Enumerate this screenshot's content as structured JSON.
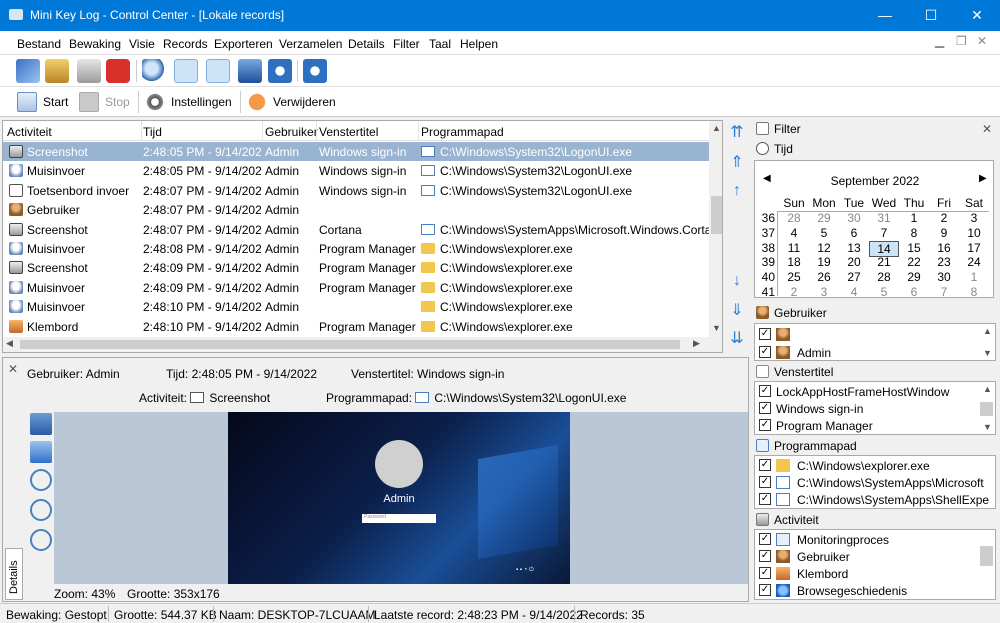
{
  "window": {
    "title": "Mini Key Log - Control Center - [Lokale records]",
    "minimize": "—",
    "maximize": "☐",
    "close": "✕"
  },
  "menu": [
    "Bestand",
    "Bewaking",
    "Visie",
    "Records",
    "Exporteren",
    "Verzamelen",
    "Details",
    "Filter",
    "Taal",
    "Helpen"
  ],
  "toolbar1_icons": [
    "edit-icon",
    "lock-icon",
    "calendar-icon",
    "power-icon",
    "search-icon",
    "filter-icon",
    "pencil-icon",
    "export-icon",
    "info-icon",
    "help-icon"
  ],
  "toolbar2": {
    "start": "Start",
    "stop": "Stop",
    "settings": "Instellingen",
    "delete": "Verwijderen"
  },
  "grid": {
    "columns": [
      "Activiteit",
      "Tijd",
      "Gebruiker",
      "Venstertitel",
      "Programmapad"
    ],
    "rows": [
      {
        "activity": "Screenshot",
        "icon": "camera",
        "time": "2:48:05 PM - 9/14/2022",
        "user": "Admin",
        "title": "Windows sign-in",
        "path": "C:\\Windows\\System32\\LogonUI.exe",
        "ptype": "win"
      },
      {
        "activity": "Muisinvoer",
        "icon": "mouse",
        "time": "2:48:05 PM - 9/14/2022",
        "user": "Admin",
        "title": "Windows sign-in",
        "path": "C:\\Windows\\System32\\LogonUI.exe",
        "ptype": "win"
      },
      {
        "activity": "Toetsenbord invoer",
        "icon": "keyboard",
        "time": "2:48:07 PM - 9/14/2022",
        "user": "Admin",
        "title": "Windows sign-in",
        "path": "C:\\Windows\\System32\\LogonUI.exe",
        "ptype": "win"
      },
      {
        "activity": "Gebruiker",
        "icon": "user",
        "time": "2:48:07 PM - 9/14/2022",
        "user": "Admin",
        "title": "",
        "path": "",
        "ptype": ""
      },
      {
        "activity": "Screenshot",
        "icon": "camera",
        "time": "2:48:07 PM - 9/14/2022",
        "user": "Admin",
        "title": "Cortana",
        "path": "C:\\Windows\\SystemApps\\Microsoft.Windows.Corta",
        "ptype": "win"
      },
      {
        "activity": "Muisinvoer",
        "icon": "mouse",
        "time": "2:48:08 PM - 9/14/2022",
        "user": "Admin",
        "title": "Program Manager",
        "path": "C:\\Windows\\explorer.exe",
        "ptype": "fold"
      },
      {
        "activity": "Screenshot",
        "icon": "camera",
        "time": "2:48:09 PM - 9/14/2022",
        "user": "Admin",
        "title": "Program Manager",
        "path": "C:\\Windows\\explorer.exe",
        "ptype": "fold"
      },
      {
        "activity": "Muisinvoer",
        "icon": "mouse",
        "time": "2:48:09 PM - 9/14/2022",
        "user": "Admin",
        "title": "Program Manager",
        "path": "C:\\Windows\\explorer.exe",
        "ptype": "fold"
      },
      {
        "activity": "Muisinvoer",
        "icon": "mouse",
        "time": "2:48:10 PM - 9/14/2022",
        "user": "Admin",
        "title": "",
        "path": "C:\\Windows\\explorer.exe",
        "ptype": "fold"
      },
      {
        "activity": "Klembord",
        "icon": "clipboard",
        "time": "2:48:10 PM - 9/14/2022",
        "user": "Admin",
        "title": "Program Manager",
        "path": "C:\\Windows\\explorer.exe",
        "ptype": "fold"
      }
    ]
  },
  "details": {
    "user_label": "Gebruiker:",
    "user": "Admin",
    "time_label": "Tijd:",
    "time": "2:48:05 PM - 9/14/2022",
    "title_label": "Venstertitel:",
    "title": "Windows sign-in",
    "activity_label": "Activiteit:",
    "activity": "Screenshot",
    "path_label": "Programmapad:",
    "path": "C:\\Windows\\System32\\LogonUI.exe",
    "zoom": "Zoom: 43%",
    "size": "Grootte: 353x176",
    "tab": "Details",
    "screen_user": "Admin",
    "screen_input_placeholder": "Password"
  },
  "filter": {
    "title": "Filter",
    "time": "Tijd",
    "calendar": {
      "month": "September 2022",
      "days": [
        "Sun",
        "Mon",
        "Tue",
        "Wed",
        "Thu",
        "Fri",
        "Sat"
      ],
      "weeks": [
        {
          "wk": "36",
          "d": [
            "28",
            "29",
            "30",
            "31",
            "1",
            "2",
            "3"
          ]
        },
        {
          "wk": "37",
          "d": [
            "4",
            "5",
            "6",
            "7",
            "8",
            "9",
            "10"
          ]
        },
        {
          "wk": "38",
          "d": [
            "11",
            "12",
            "13",
            "14",
            "15",
            "16",
            "17"
          ]
        },
        {
          "wk": "39",
          "d": [
            "18",
            "19",
            "20",
            "21",
            "22",
            "23",
            "24"
          ]
        },
        {
          "wk": "40",
          "d": [
            "25",
            "26",
            "27",
            "28",
            "29",
            "30",
            "1"
          ]
        },
        {
          "wk": "41",
          "d": [
            "2",
            "3",
            "4",
            "5",
            "6",
            "7",
            "8"
          ]
        }
      ],
      "selected": "14"
    },
    "users_title": "Gebruiker",
    "users": [
      "",
      "Admin"
    ],
    "windows_title": "Venstertitel",
    "windows": [
      "LockAppHostFrameHostWindow",
      "Windows sign-in",
      "Program Manager"
    ],
    "paths_title": "Programmapad",
    "paths": [
      "C:\\Windows\\explorer.exe",
      "C:\\Windows\\SystemApps\\Microsoft",
      "C:\\Windows\\SystemApps\\ShellExpe"
    ],
    "activity_title": "Activiteit",
    "activities": [
      "Monitoringproces",
      "Gebruiker",
      "Klembord",
      "Browsegeschiedenis"
    ]
  },
  "status": {
    "monitoring": "Bewaking: Gestopt",
    "size": "Grootte: 544.37 KB",
    "name": "Naam: DESKTOP-7LCUAAM",
    "last": "Laatste record: 2:48:23 PM - 9/14/2022",
    "records": "Records: 35"
  },
  "colors": {
    "titlebar": "#0078d7",
    "selection": "#99b4d1"
  }
}
